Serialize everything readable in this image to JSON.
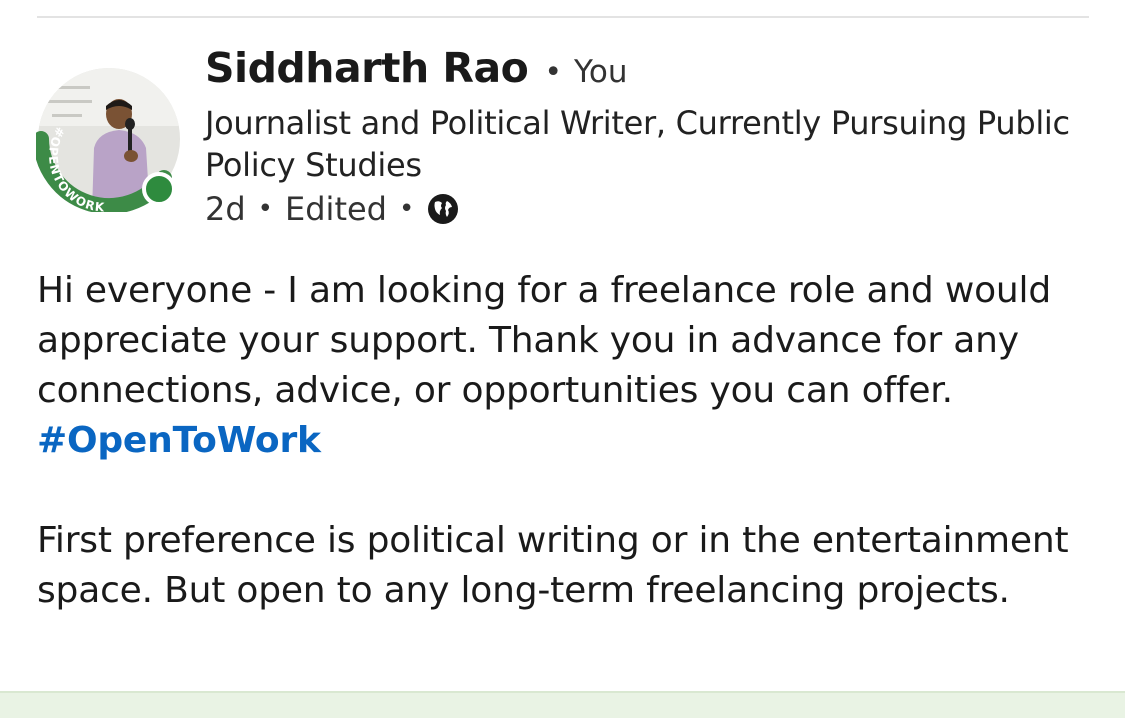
{
  "post": {
    "author": {
      "name": "Siddharth Rao",
      "relation": "You",
      "headline": "Journalist and Political Writer, Currently Pursuing Public Policy Studies",
      "avatar_badge": "#OPENTOWORK",
      "presence": "online"
    },
    "meta": {
      "age": "2d",
      "edited": "Edited",
      "visibility_icon": "globe-icon"
    },
    "body": {
      "paragraph1": "Hi everyone - I am looking for a freelance role and would appreciate your support. Thank you in advance for any connections, advice, or opportunities you can offer.",
      "hashtag": "#OpenToWork",
      "paragraph2": "First preference is political writing or in the entertainment space. But open to any long-term freelancing projects."
    }
  },
  "colors": {
    "hashtag": "#0a66c2",
    "open_to_work_ring": "#3d8b47",
    "presence_dot": "#2e8b3e",
    "bottom_bar": "#e9f3e4"
  }
}
